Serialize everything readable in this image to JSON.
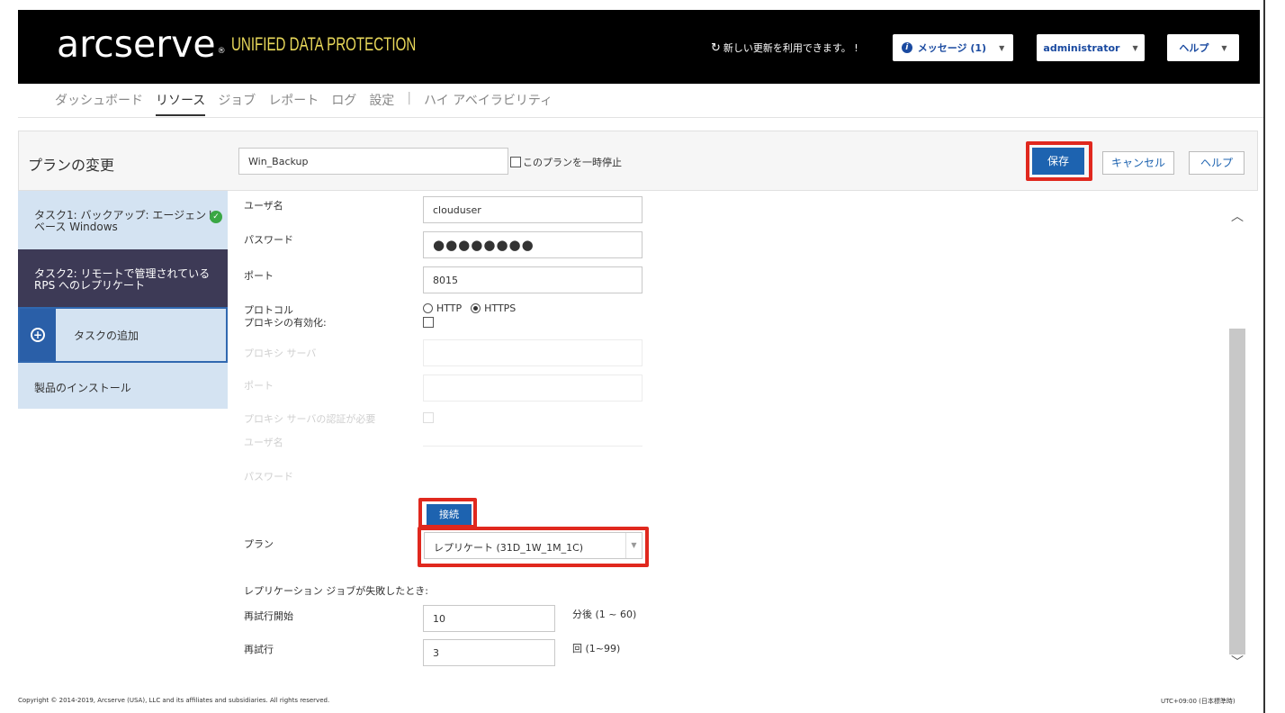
{
  "header": {
    "logo": "arcserve",
    "logo_mark": "®",
    "product": "UNIFIED DATA PROTECTION",
    "update_msg": "新しい更新を利用できます。 !",
    "messages_label": "メッセージ (1)",
    "user_label": "administrator",
    "help_label": "ヘルプ"
  },
  "nav": {
    "items": [
      "ダッシュボード",
      "リソース",
      "ジョブ",
      "レポート",
      "ログ",
      "設定",
      "|",
      "ハイ アベイラビリティ"
    ]
  },
  "planbar": {
    "title": "プランの変更",
    "plan_name": "Win_Backup",
    "pause_label": "このプランを一時停止",
    "save_label": "保存",
    "cancel_label": "キャンセル",
    "help_label": "ヘルプ"
  },
  "sidebar": {
    "task1_line1": "タスク1: バックアップ: エージェント",
    "task1_line2": "ベース Windows",
    "task2_line1": "タスク2: リモートで管理されている",
    "task2_line2": "RPS へのレプリケート",
    "add_task": "タスクの追加",
    "install": "製品のインストール"
  },
  "form": {
    "username_label": "ユーザ名",
    "username_value": "clouduser",
    "password_label": "パスワード",
    "password_value": "●●●●●●●●",
    "port_label": "ポート",
    "port_value": "8015",
    "protocol_label": "プロトコル",
    "protocol_http": "HTTP",
    "protocol_https": "HTTPS",
    "proxy_enable_label": "プロキシの有効化:",
    "proxy_server_label": "プロキシ サーバ",
    "proxy_port_label": "ポート",
    "proxy_auth_label": "プロキシ サーバの認証が必要",
    "proxy_user_label": "ユーザ名",
    "proxy_password_label": "パスワード",
    "connect_label": "接続",
    "plan_label": "プラン",
    "plan_value": "レプリケート (31D_1W_1M_1C)",
    "fail_label": "レプリケーション ジョブが失敗したとき:",
    "retry_start_label": "再試行開始",
    "retry_start_value": "10",
    "retry_start_suffix": "分後 (1 ~ 60)",
    "retry_label": "再試行",
    "retry_value": "3",
    "retry_suffix": "回 (1~99)"
  },
  "footer": {
    "copyright": "Copyright © 2014-2019, Arcserve (USA), LLC and its affiliates and subsidiaries. All rights reserved.",
    "timezone": "UTC+09:00 (日本標準時)"
  },
  "colors": {
    "header_bg": "#000000",
    "accent": "#1d63b0",
    "highlight": "#e0281e",
    "sidebar_active": "#3d3a56",
    "sidebar_bg": "#d4e3f2"
  }
}
